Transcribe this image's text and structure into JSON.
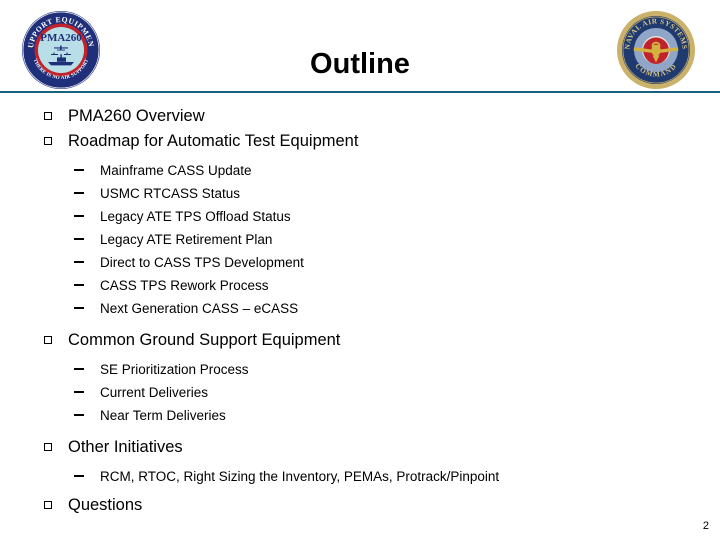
{
  "slide": {
    "title": "Outline",
    "page_number": "2",
    "rule_color": "#19617f"
  },
  "logos": {
    "left": {
      "name": "pma260-support-equipment-seal",
      "top_text": "SUPPORT EQUIPMENT",
      "center_text": "PMA260",
      "bottom_text": "THERE IS NO AIR SUPPORT WITHOUT GROUND SUPPORT",
      "ring_color": "#1f2f7a",
      "inner_ring_color": "#c0232c",
      "center_color": "#b8dfe8"
    },
    "right": {
      "name": "naval-air-systems-command-seal",
      "top_text": "NAVAL AIR SYSTEMS",
      "bottom_text": "COMMAND",
      "outer_ring_color": "#cbb26a",
      "inner_ring_color": "#1f3a6e",
      "field_color": "#8fa6c8",
      "emblem_color": "#c0232c",
      "wing_color": "#d4b23f"
    }
  },
  "outline": [
    {
      "label": "PMA260 Overview",
      "children": []
    },
    {
      "label": "Roadmap for Automatic Test Equipment",
      "children": [
        "Mainframe CASS Update",
        "USMC RTCASS Status",
        "Legacy ATE TPS Offload Status",
        "Legacy ATE Retirement Plan",
        "Direct to CASS TPS Development",
        "CASS TPS Rework Process",
        "Next Generation CASS – eCASS"
      ]
    },
    {
      "label": "Common Ground Support Equipment",
      "children": [
        "SE Prioritization Process",
        "Current Deliveries",
        "Near Term Deliveries"
      ]
    },
    {
      "label": "Other Initiatives",
      "children": [
        "RCM, RTOC, Right Sizing the Inventory, PEMAs, Protrack/Pinpoint"
      ]
    },
    {
      "label": "Questions",
      "children": []
    }
  ]
}
